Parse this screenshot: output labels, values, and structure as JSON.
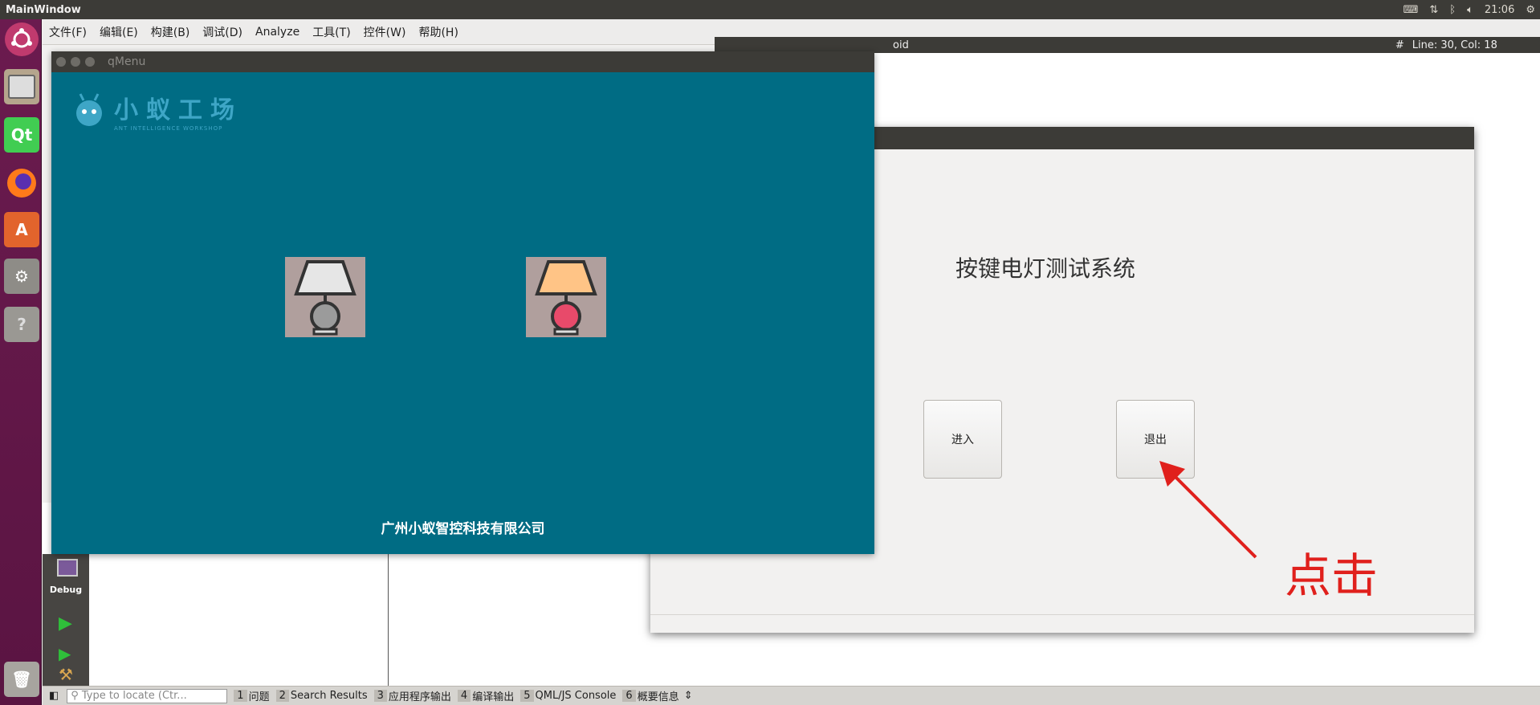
{
  "topbar": {
    "title": "MainWindow",
    "clock": "21:06"
  },
  "menubar": {
    "items": [
      "文件(F)",
      "编辑(E)",
      "构建(B)",
      "调试(D)",
      "Analyze",
      "工具(T)",
      "控件(W)",
      "帮助(H)"
    ]
  },
  "editor": {
    "file_fragment": "oid",
    "position": "Line: 30, Col: 18",
    "hash": "#"
  },
  "qmenu": {
    "title": "qMenu",
    "logo_text": "小蚁工场",
    "logo_sub": "ANT INTELLIGENCE WORKSHOP",
    "footer": "广州小蚁智控科技有限公司",
    "lamp_off_color": "#e6e6e6",
    "lamp_on_color": "#ffc486"
  },
  "dialog": {
    "heading": "按键电灯测试系统",
    "enter_label": "进入",
    "exit_label": "退出"
  },
  "annotation": {
    "text": "点击",
    "color": "#e0201c"
  },
  "modebar": {
    "debug_label": "Debug"
  },
  "bottombar": {
    "locate_placeholder": "Type to locate (Ctr...",
    "tabs": [
      {
        "num": "1",
        "label": "问题"
      },
      {
        "num": "2",
        "label": "Search Results"
      },
      {
        "num": "3",
        "label": "应用程序输出"
      },
      {
        "num": "4",
        "label": "编译输出"
      },
      {
        "num": "5",
        "label": "QML/JS Console"
      },
      {
        "num": "6",
        "label": "概要信息"
      }
    ]
  }
}
